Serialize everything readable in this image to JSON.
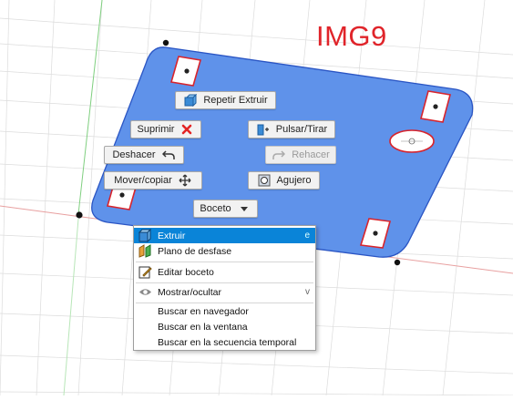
{
  "watermark": "IMG9",
  "marking_menu": {
    "repeat_extrude": "Repetir Extruir",
    "delete": "Suprimir",
    "press_pull": "Pulsar/Tirar",
    "undo": "Deshacer",
    "redo": "Rehacer",
    "move_copy": "Mover/copiar",
    "hole": "Agujero",
    "sketch": "Boceto"
  },
  "context_menu": {
    "items": [
      {
        "label": "Extruir",
        "shortcut": "e",
        "icon": "extrude-icon",
        "selected": true
      },
      {
        "label": "Plano de desfase",
        "icon": "offset-plane-icon"
      },
      {
        "label": "Editar boceto",
        "icon": "edit-sketch-icon"
      },
      {
        "label": "Mostrar/ocultar",
        "shortcut": "v",
        "icon": "eye-icon"
      },
      {
        "label": "Buscar en navegador"
      },
      {
        "label": "Buscar en la ventana"
      },
      {
        "label": "Buscar en la secuencia temporal"
      }
    ]
  },
  "colors": {
    "plate_fill": "#5f92ea",
    "plate_stroke": "#2a55c4",
    "selection_accent": "#0a84d8",
    "hole_outline": "#d8242c",
    "watermark": "#e0242a"
  }
}
